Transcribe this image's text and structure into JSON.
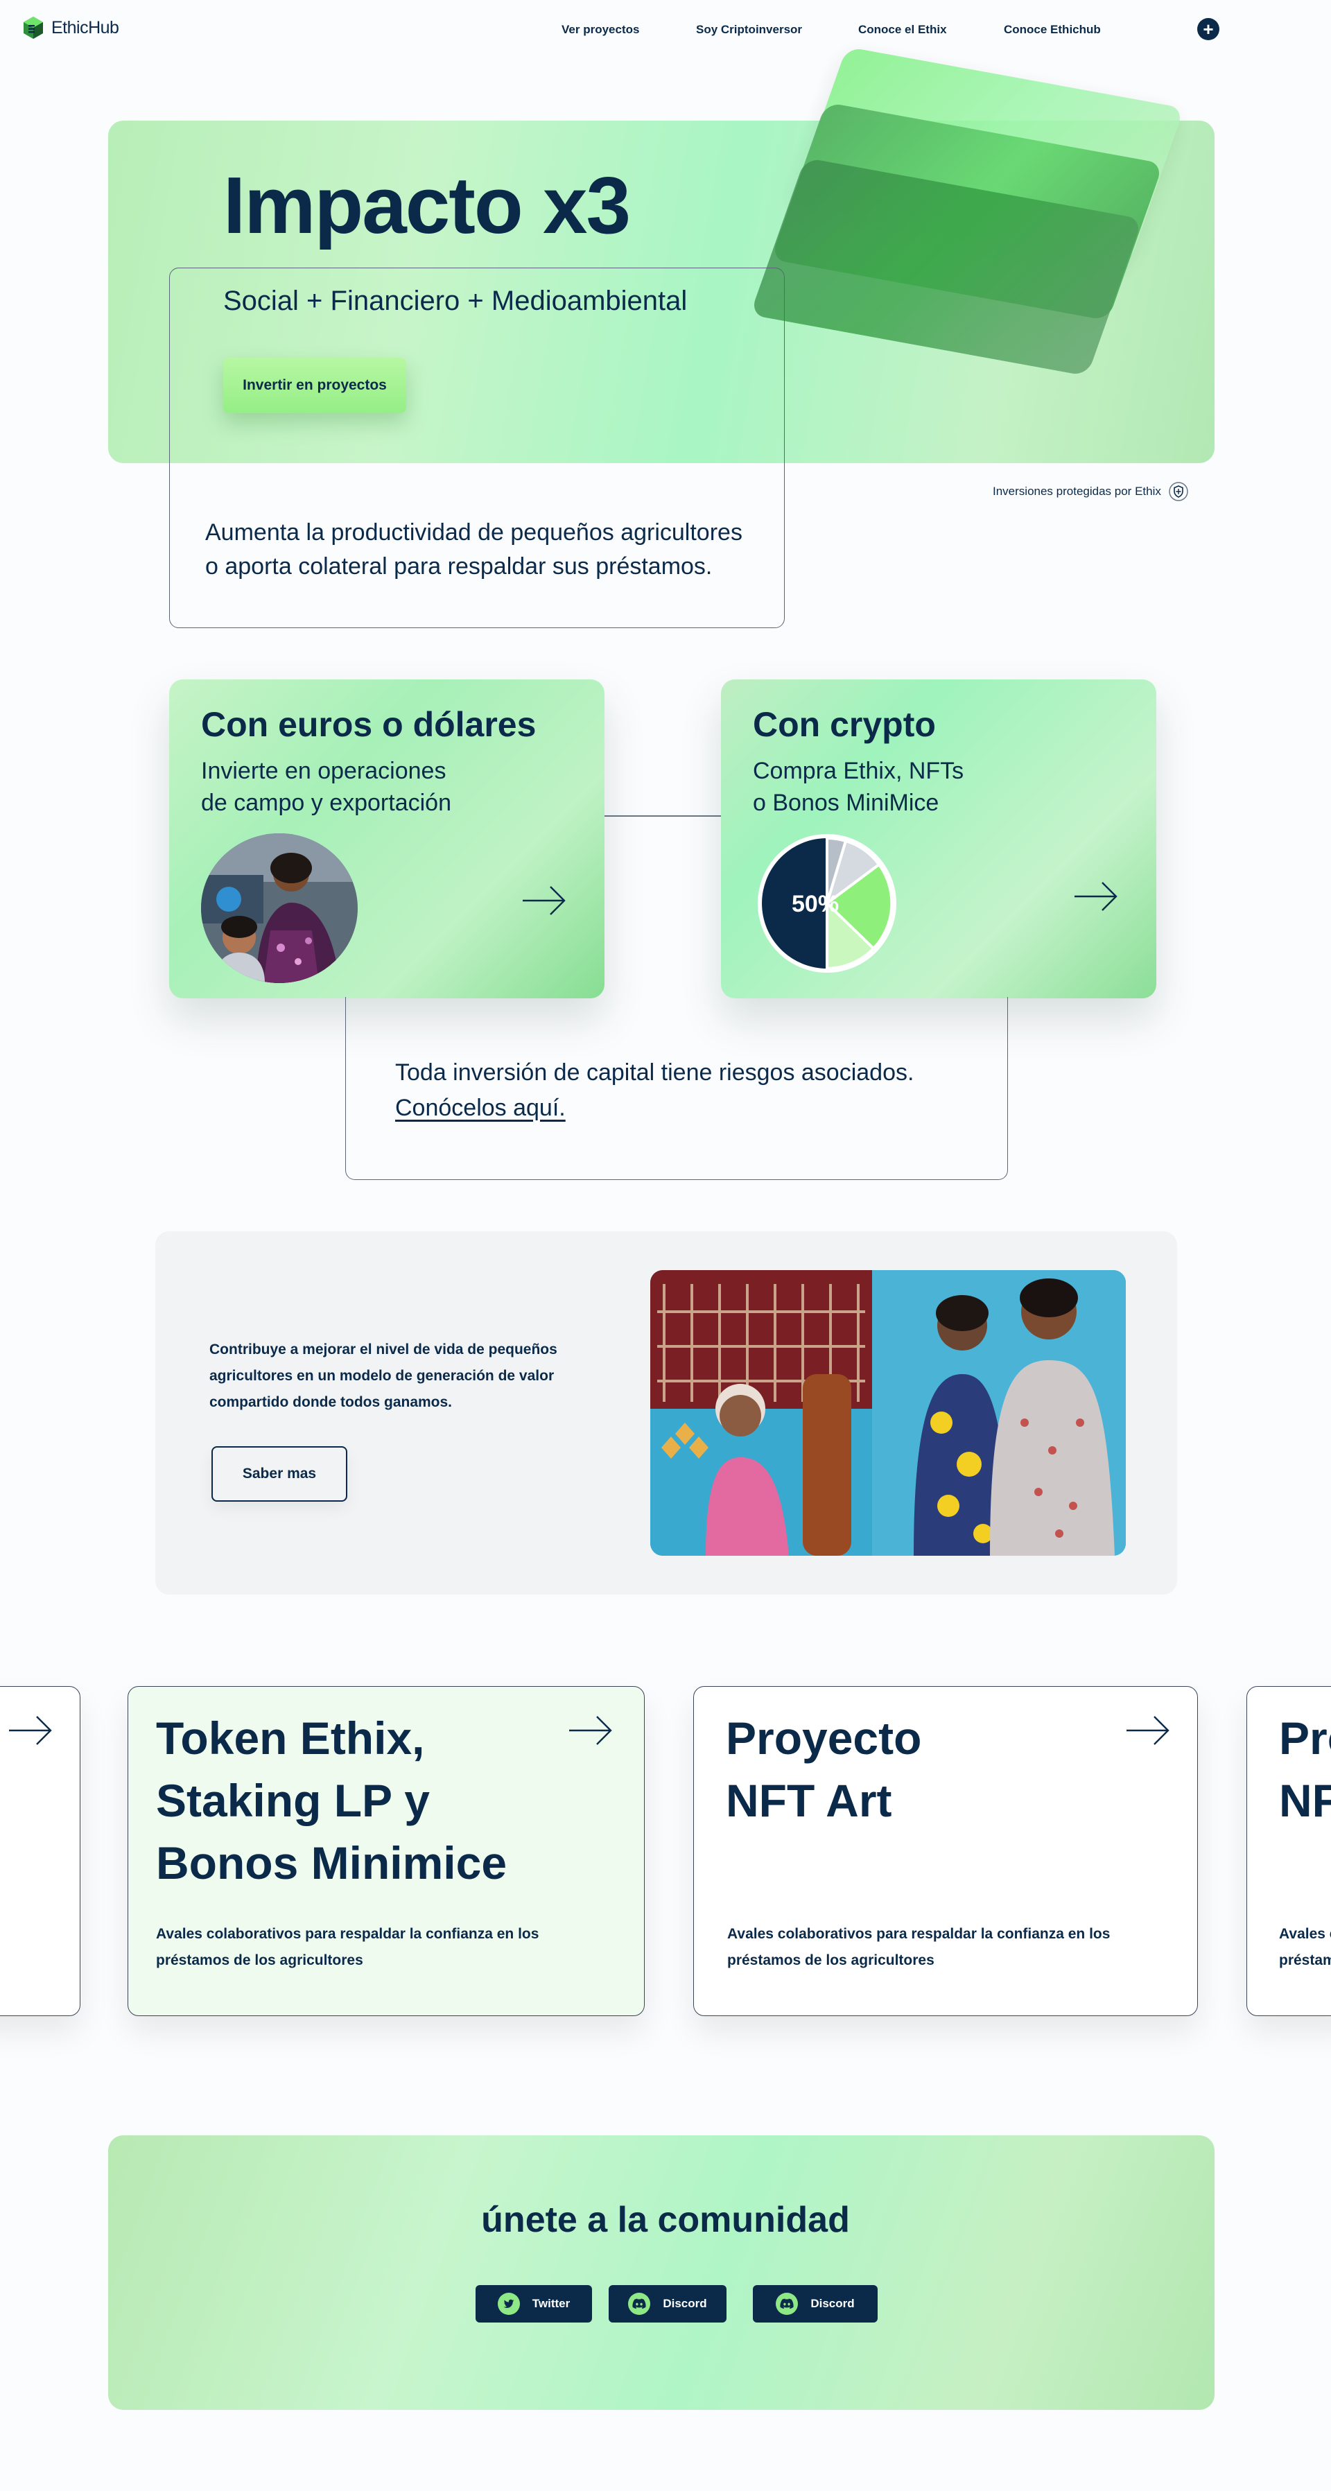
{
  "nav": {
    "brand": "EthicHub",
    "links": [
      "Ver proyectos",
      "Soy Criptoinversor",
      "Conoce el Ethix",
      "Conoce Ethichub"
    ]
  },
  "hero": {
    "title": "Impacto x3",
    "subtitle": "Social + Financiero + Medioambiental",
    "cta": "Invertir en proyectos",
    "protected": "Inversiones protegidas por Ethix",
    "description_line1": "Aumenta la productividad de pequeños agricultores",
    "description_line2": "o aporta colateral para respaldar sus préstamos."
  },
  "cards": [
    {
      "title": "Con euros o dólares",
      "line1": "Invierte en operaciones",
      "line2": "de campo y exportación"
    },
    {
      "title": "Con crypto",
      "line1": "Compra Ethix, NFTs",
      "line2": "o Bonos MiniMice",
      "pie_label": "50%"
    }
  ],
  "risk": {
    "text": "Toda inversión de capital tiene riesgos asociados.",
    "link": "Conócelos aquí."
  },
  "contribute": {
    "text": "Contribuye a mejorar el nivel de vida de pequeños agricultores en un modelo de generación de valor compartido donde todos ganamos.",
    "button": "Saber mas"
  },
  "projects": [
    {
      "title": "Token Ethix,\nStaking LP y\nBonos Minimice",
      "desc": "Avales colaborativos para respaldar la confianza en los préstamos de los agricultores"
    },
    {
      "title": "Proyecto\nNFT Art",
      "desc": "Avales colaborativos para respaldar la confianza en los préstamos de los agricultores"
    },
    {
      "title": "Proyecto\nNFT Art",
      "desc": "Avales colaborativos para respaldar la confianza en los préstamos de los agricultores"
    }
  ],
  "community": {
    "title": "únete a la comunidad",
    "buttons": [
      "Twitter",
      "Discord",
      "Discord"
    ]
  },
  "colors": {
    "navy": "#0b2a4a",
    "green_accent": "#95ee86",
    "hero_green": "#b8eeb8"
  },
  "icons": [
    "logo-cube-icon",
    "plus-icon",
    "shield-icon",
    "arrow-right-icon",
    "twitter-icon",
    "discord-icon"
  ]
}
